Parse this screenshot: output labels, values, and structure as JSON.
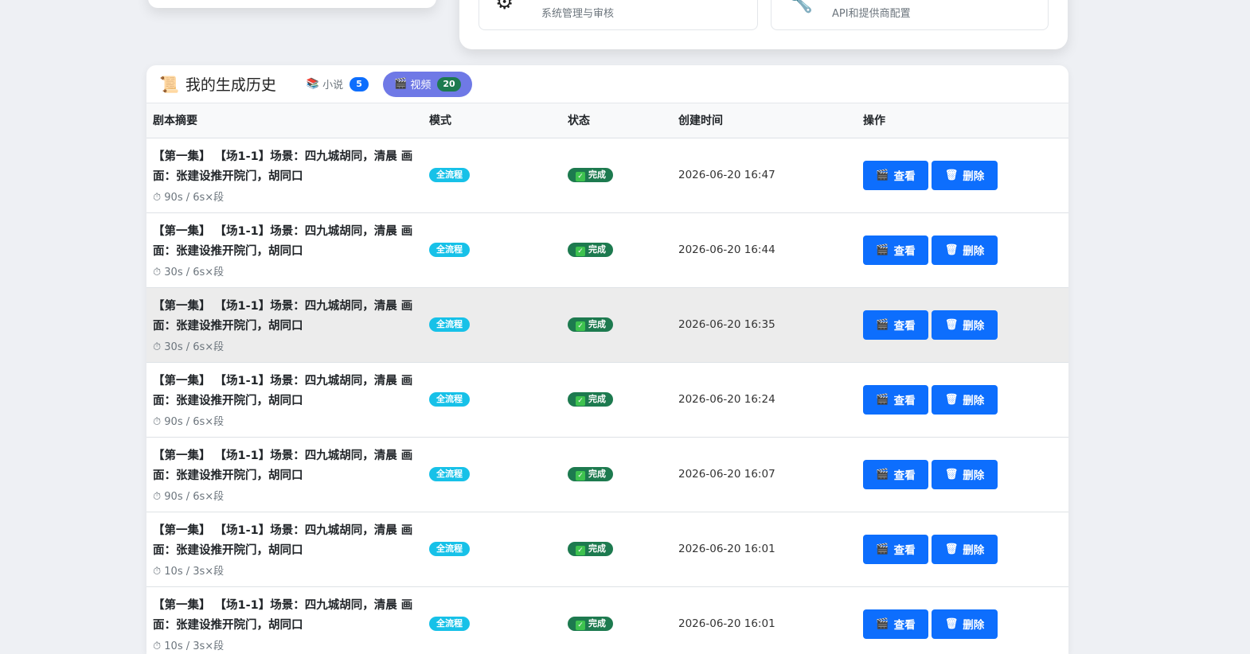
{
  "top_panel": {
    "cards": [
      {
        "icon": "gear-icon",
        "glyph": "⚙",
        "desc": "系统管理与审核"
      },
      {
        "icon": "wrench-icon",
        "glyph": "🔧",
        "desc": "API和提供商配置"
      }
    ]
  },
  "history": {
    "title_icon": "📜",
    "title": "我的生成历史",
    "tabs": [
      {
        "icon": "📚",
        "label": "小说",
        "count": "5"
      },
      {
        "icon": "🎬",
        "label": "视频",
        "count": "20"
      }
    ],
    "columns": {
      "summary": "剧本摘要",
      "mode": "模式",
      "status": "状态",
      "created": "创建时间",
      "actions": "操作"
    },
    "view_label": "查看",
    "delete_label": "删除",
    "view_icon": "🎬",
    "delete_icon": "🗑",
    "rows": [
      {
        "summary": "【第一集】 【场1-1】场景：四九城胡同，清晨 画面：张建设推开院门，胡同口",
        "meta": "⏱ 90s / 6s×段",
        "mode": "全流程",
        "status": "完成",
        "time": "2026-06-20 16:47"
      },
      {
        "summary": "【第一集】 【场1-1】场景：四九城胡同，清晨 画面：张建设推开院门，胡同口",
        "meta": "⏱ 30s / 6s×段",
        "mode": "全流程",
        "status": "完成",
        "time": "2026-06-20 16:44"
      },
      {
        "summary": "【第一集】 【场1-1】场景：四九城胡同，清晨 画面：张建设推开院门，胡同口",
        "meta": "⏱ 30s / 6s×段",
        "mode": "全流程",
        "status": "完成",
        "time": "2026-06-20 16:35"
      },
      {
        "summary": "【第一集】 【场1-1】场景：四九城胡同，清晨 画面：张建设推开院门，胡同口",
        "meta": "⏱ 90s / 6s×段",
        "mode": "全流程",
        "status": "完成",
        "time": "2026-06-20 16:24"
      },
      {
        "summary": "【第一集】 【场1-1】场景：四九城胡同，清晨 画面：张建设推开院门，胡同口",
        "meta": "⏱ 90s / 6s×段",
        "mode": "全流程",
        "status": "完成",
        "time": "2026-06-20 16:07"
      },
      {
        "summary": "【第一集】 【场1-1】场景：四九城胡同，清晨 画面：张建设推开院门，胡同口",
        "meta": "⏱ 10s / 3s×段",
        "mode": "全流程",
        "status": "完成",
        "time": "2026-06-20 16:01"
      },
      {
        "summary": "【第一集】 【场1-1】场景：四九城胡同，清晨 画面：张建设推开院门，胡同口",
        "meta": "⏱ 10s / 3s×段",
        "mode": "全流程",
        "status": "完成",
        "time": "2026-06-20 16:01"
      }
    ]
  }
}
